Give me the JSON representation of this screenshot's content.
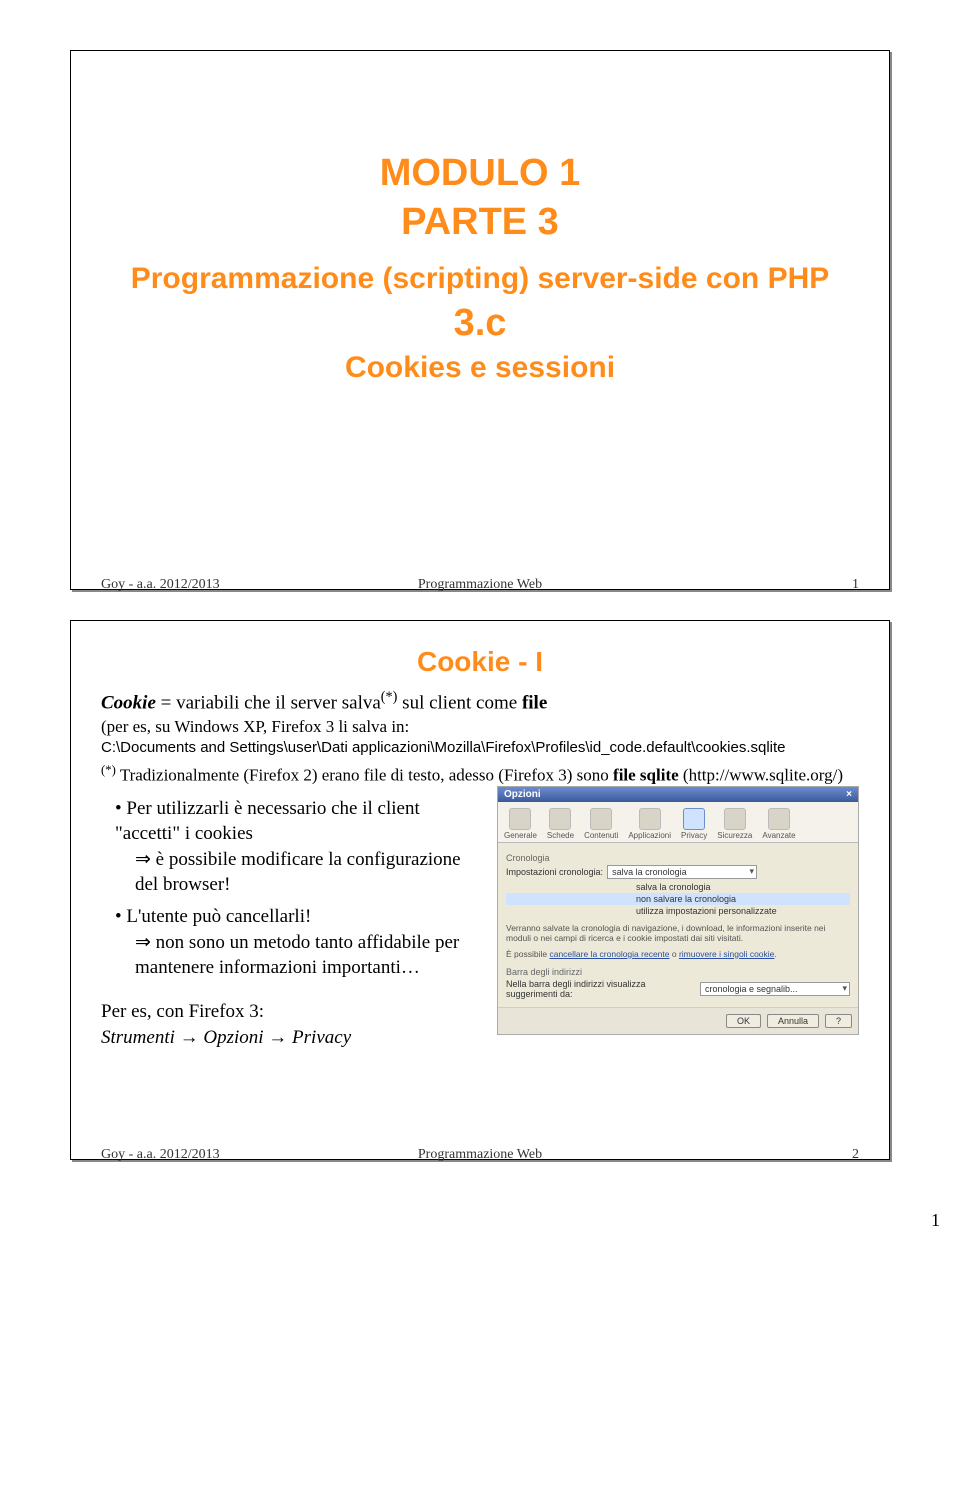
{
  "slide1": {
    "title1": "MODULO 1",
    "title2": "PARTE 3",
    "subtitle1": "Programmazione (scripting) server-side con PHP",
    "subtitle2": "3.c",
    "subtitle3": "Cookies e sessioni",
    "footer_left": "Goy - a.a. 2012/2013",
    "footer_center": "Programmazione Web",
    "footer_right": "1"
  },
  "slide2": {
    "heading": "Cookie - I",
    "para1_pre": "Cookie",
    "para1_mid": " = variabili che il server salva",
    "para1_sup": "(*)",
    "para1_post": " sul client come ",
    "para1_bold": "file",
    "path_intro": "(per es, su Windows XP, Firefox 3 li salva in:",
    "path_line1": "C:\\Documents and Settings\\user\\Dati applicazioni\\Mozilla\\Firefox\\Profiles\\id_code.default\\cookies.sqlite",
    "note_sup": "(*)",
    "note_text_a": " Tradizionalmente (Firefox 2) erano file di testo, adesso (Firefox 3) sono ",
    "note_bold": "file sqlite",
    "note_text_b": " (http://www.sqlite.org/)",
    "bullet1_a": "Per utilizzarli è necessario che il client \"accetti\" i cookies",
    "bullet1_b": "⇒ è possibile modificare la configurazione del browser!",
    "bullet2_a": "L'utente può cancellarli!",
    "bullet2_b": "⇒ non sono un metodo tanto affidabile per mantenere informazioni importanti…",
    "example_label": "Per es, con Firefox 3:",
    "example_path": "Strumenti → Opzioni → Privacy",
    "footer_left": "Goy - a.a. 2012/2013",
    "footer_center": "Programmazione Web",
    "footer_right": "2",
    "dialog": {
      "title": "Opzioni",
      "close": "×",
      "tabs": [
        "Generale",
        "Schede",
        "Contenuti",
        "Applicazioni",
        "Privacy",
        "Sicurezza",
        "Avanzate"
      ],
      "group1": "Cronologia",
      "label1": "Impostazioni cronologia:",
      "select_value": "salva la cronologia",
      "opt1": "salva la cronologia",
      "opt2": "non salvare la cronologia",
      "opt3": "utilizza impostazioni personalizzate",
      "info1": "Verranno salvate la cronologia di navigazione, i download, le informazioni inserite nei moduli o nei campi di ricerca e i cookie impostati dai siti visitati.",
      "info2_pre": "È possibile ",
      "info2_link1": "cancellare la cronologia recente",
      "info2_mid": " o ",
      "info2_link2": "rimuovere i singoli cookie",
      "info2_post": ".",
      "group2": "Barra degli indirizzi",
      "label2": "Nella barra degli indirizzi visualizza suggerimenti da:",
      "select2_value": "cronologia e segnalib...",
      "btn_ok": "OK",
      "btn_cancel": "Annulla",
      "btn_help": "?"
    }
  },
  "page_number": "1"
}
